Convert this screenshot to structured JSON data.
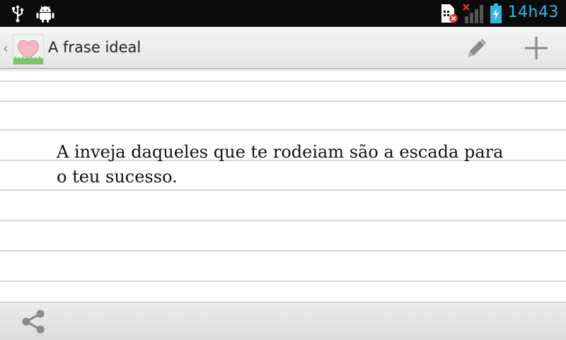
{
  "status_bar": {
    "time": "14h43",
    "icons": [
      "usb-icon",
      "android-debug-icon",
      "sim-missing-icon",
      "signal-no-service-icon",
      "battery-charging-icon"
    ]
  },
  "action_bar": {
    "title": "A frase ideal",
    "logo_text": "a frase ideal",
    "actions": [
      "edit-icon",
      "add-icon"
    ]
  },
  "content": {
    "quote": "A inveja daqueles que te rodeiam são a escada para o teu sucesso."
  },
  "bottom_bar": {
    "actions": [
      "share-icon"
    ]
  },
  "colors": {
    "accent": "#33b5e5",
    "statusbar_bg": "#0b0b0b",
    "icon_gray": "#8a8a8a"
  }
}
